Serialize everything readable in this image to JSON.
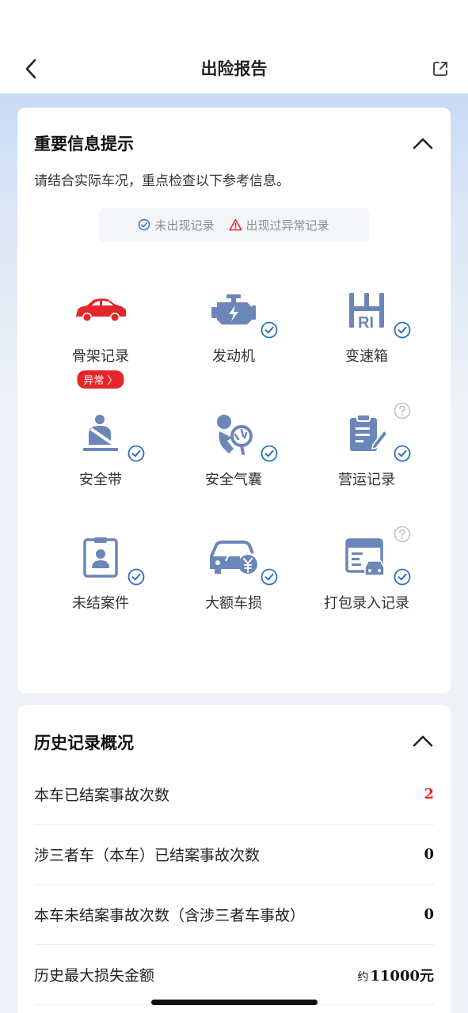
{
  "nav": {
    "title": "出险报告"
  },
  "important": {
    "title": "重要信息提示",
    "subtitle": "请结合实际车况，重点检查以下参考信息。",
    "legend": {
      "ok": "未出现记录",
      "warn": "出现过异常记录"
    },
    "items": [
      {
        "label": "骨架记录",
        "icon": "car-frame-icon",
        "status": "abnormal",
        "badge": "异常 〉"
      },
      {
        "label": "发动机",
        "icon": "engine-icon",
        "status": "ok"
      },
      {
        "label": "变速箱",
        "icon": "gearbox-icon",
        "status": "ok"
      },
      {
        "label": "安全带",
        "icon": "seatbelt-icon",
        "status": "ok"
      },
      {
        "label": "安全气囊",
        "icon": "airbag-icon",
        "status": "ok"
      },
      {
        "label": "营运记录",
        "icon": "operation-record-icon",
        "status": "ok",
        "help": true
      },
      {
        "label": "未结案件",
        "icon": "unclosed-case-icon",
        "status": "ok"
      },
      {
        "label": "大额车损",
        "icon": "large-damage-icon",
        "status": "ok"
      },
      {
        "label": "打包录入记录",
        "icon": "package-record-icon",
        "status": "ok",
        "help": true
      }
    ]
  },
  "history": {
    "title": "历史记录概况",
    "rows": [
      {
        "label": "本车已结案事故次数",
        "value": "2",
        "highlight": true
      },
      {
        "label": "涉三者车（本车）已结案事故次数",
        "value": "0"
      },
      {
        "label": "本车未结案事故次数（含涉三者车事故）",
        "value": "0"
      },
      {
        "label": "历史最大损失金额",
        "prefix": "约",
        "value": "11000元"
      }
    ]
  },
  "colors": {
    "accent": "#2f6fbd",
    "danger": "#e5262b",
    "icon": "#6b86b8"
  }
}
